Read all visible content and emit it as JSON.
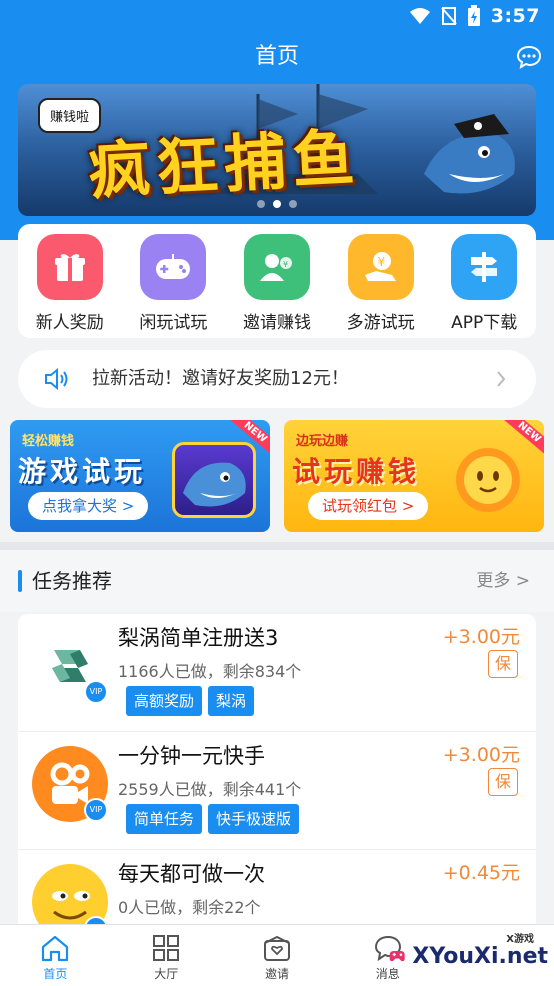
{
  "status_bar": {
    "time": "3:57"
  },
  "header": {
    "title": "首页"
  },
  "banner": {
    "tag": "赚钱啦",
    "title": "疯狂捕鱼"
  },
  "quick_icons": [
    {
      "label": "新人奖励",
      "icon": "gift-icon",
      "color": "#fb5a6e"
    },
    {
      "label": "闲玩试玩",
      "icon": "gamepad-icon",
      "color": "#9b82f2"
    },
    {
      "label": "邀请赚钱",
      "icon": "invite-user-icon",
      "color": "#3ebf7a"
    },
    {
      "label": "多游试玩",
      "icon": "coin-hand-icon",
      "color": "#ffb82b"
    },
    {
      "label": "APP下载",
      "icon": "signpost-icon",
      "color": "#2fa4f5"
    }
  ],
  "notice": {
    "text": "拉新活动！邀请好友奖励12元！"
  },
  "promos": {
    "left": {
      "small": "轻松赚钱",
      "big": "游戏试玩",
      "button": "点我拿大奖 >",
      "badge": "NEW"
    },
    "right": {
      "small": "边玩边赚",
      "big": "试玩赚钱",
      "button": "试玩领红包 >",
      "badge": "NEW"
    }
  },
  "tasks_section": {
    "title": "任务推荐",
    "more": "更多 >"
  },
  "tasks": [
    {
      "name": "梨涡简单注册送3",
      "meta": "1166人已做，剩余834个",
      "chips": [
        "高额奖励",
        "梨涡"
      ],
      "price": "+3.00元",
      "badge": "保",
      "avatar_color": "#2f7d6a",
      "vip": "VIP"
    },
    {
      "name": "一分钟一元快手",
      "meta": "2559人已做，剩余441个",
      "chips": [
        "简单任务",
        "快手极速版"
      ],
      "price": "+3.00元",
      "badge": "保",
      "avatar_color": "#ff8a1f",
      "vip": "VIP"
    },
    {
      "name": "每天都可做一次",
      "meta": "0人已做，剩余22个",
      "chips": [],
      "price": "+0.45元",
      "badge": "",
      "avatar_color": "#ffcf2f",
      "vip": "VIP"
    }
  ],
  "tabbar": [
    {
      "label": "首页",
      "icon": "home-icon",
      "active": true
    },
    {
      "label": "大厅",
      "icon": "grid-icon",
      "active": false
    },
    {
      "label": "邀请",
      "icon": "invite-icon",
      "active": false
    },
    {
      "label": "消息",
      "icon": "message-icon",
      "active": false
    }
  ],
  "watermark": {
    "text": "XYouXi.net",
    "small": "X游戏"
  }
}
